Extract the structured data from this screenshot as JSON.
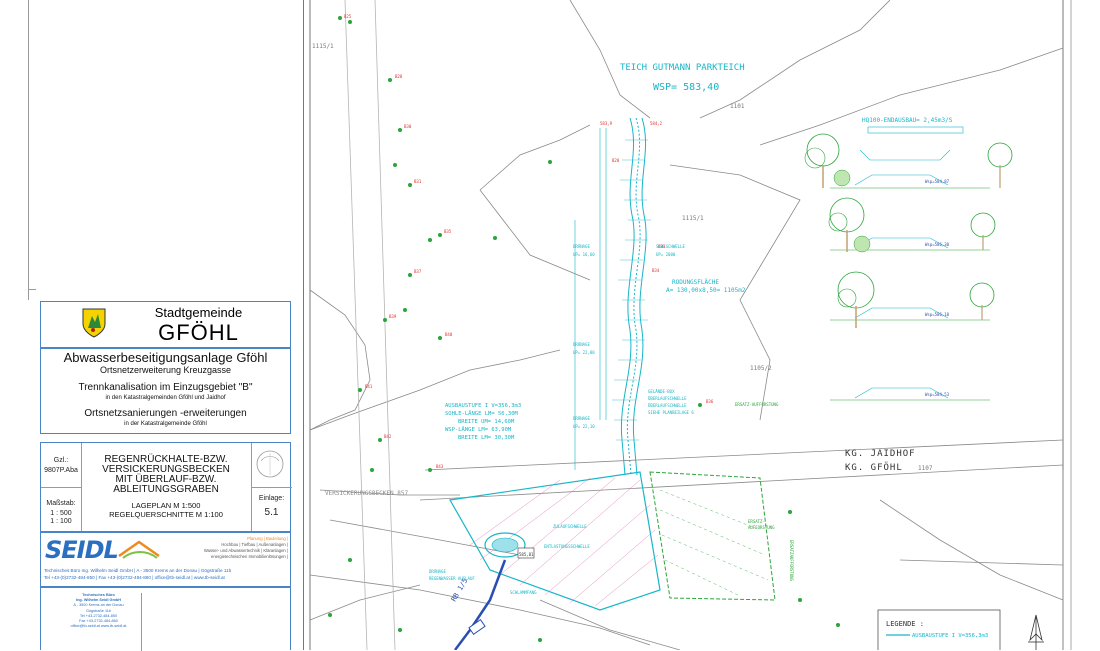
{
  "title_block": {
    "municipality_small": "Stadtgemeinde",
    "municipality_big": "GFÖHL",
    "project_title": "Abwasserbeseitigungsanlage Gföhl",
    "project_subtitle": "Ortsnetzerweiterung Kreuzgasse",
    "section1_title": "Trennkanalisation im Einzugsgebiet \"B\"",
    "section1_sub": "in den Katastralgemeinden Gföhl und Jaidhof",
    "section2_title": "Ortsnetzsanierungen -erweiterungen",
    "section2_sub": "in der Katastralgemeinde Gföhl",
    "gzl_label": "Gzl.:",
    "gzl_value": "9807P.Aba",
    "drawing_title_lines": [
      "REGENRÜCKHALTE-BZW.",
      "VERSICKERUNGSBECKEN",
      "MIT ÜBERLAUF-BZW.",
      "ABLEITUNGSGRABEN"
    ],
    "scale_line1": "LAGEPLAN M 1:500",
    "scale_line2": "REGELQUERSCHNITTE M 1:100",
    "massstab_label": "Maßstab:",
    "massstab_values": [
      "1 : 500",
      "1 : 100"
    ],
    "einlage_label": "Einlage:",
    "einlage_value": "5.1",
    "firm_logo": "SEIDL",
    "firm_services": [
      "Planung | Bauleitung |",
      "Hochbau | Tiefbau | Außenanlagen |",
      "Wasser- und Abwassertechnik | Kläranlagen |",
      "energietechnischen Immobilienlösungen |"
    ],
    "firm_line1": "Technisches Büro Ing. Wilhelm Seidl GmbH | A - 3500 Krems an der Donau | Gögstraße 11b",
    "firm_line2": "Tel +43-(0)2732-484-850 | Fax +43-(0)2732-484-860 | office@tb-seidl.at | www.tb-seidl.at",
    "stamp_lines": [
      "Technisches Büro",
      "Ing. Wilhelm Seidl GmbH",
      "A - 3500 Krems an der Donau",
      "Gögstraße 11b",
      "Tel +43-2732-484-850",
      "Fax +43-2732-484-860",
      "office@tb-seidl.at www.tb-seidl.at"
    ]
  },
  "plan": {
    "pond_label": "TEICH GUTMANN PARKTEICH",
    "pond_level": "WSP= 583,40",
    "hq_label": "HQ100-ENDAUSBAU= 2,45m3/S",
    "parcel_labels": [
      "1115/1",
      "1101",
      "1115/1",
      "1105/2",
      "1107"
    ],
    "boundary_north": "KG. JAIDHOF",
    "boundary_south": "KG. GFÖHL",
    "infiltration_label": "VERSICKERUNGSBECKEN 857",
    "rodung_label": "RODUNGSFLÄCHE",
    "rodung_value": "A= 130,00x8,50= 1105m2",
    "stage_text": [
      "AUSBAUSTUFE I V=356,3m3",
      "SOHLE-LÄNGE LM= 56,30M",
      "BREITE UM= 14,60M",
      "WSP-LÄNGE LM= 63,90M",
      "BREITE LM= 30,30M"
    ],
    "legend_title": "LEGENDE :",
    "legend_item": "AUSBAUSTUFE I V=356,3m3",
    "section_wsp": [
      "Wsp=584,87",
      "Wsp=586,30",
      "Wsp=586,10",
      "Wsp=584,53"
    ]
  },
  "colors": {
    "frame_blue": "#4a86c5",
    "cad_cyan": "#17b6c8",
    "cad_green": "#2aa53a",
    "cad_red": "#e03030",
    "cad_gray": "#8a8a8a",
    "seidl_blue": "#2a6fc0",
    "seidl_green": "#7cc242",
    "seidl_orange": "#f08a1f"
  },
  "icons": [
    "municipal-shield-icon",
    "north-arrow-icon",
    "tree-icon",
    "compass-stamp-icon"
  ]
}
